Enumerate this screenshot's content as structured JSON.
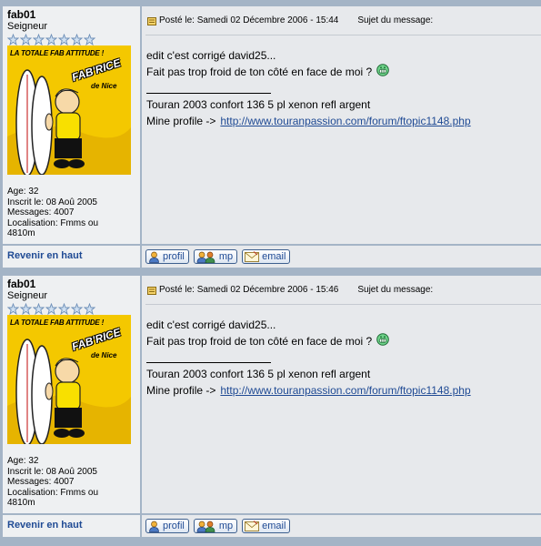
{
  "posts": [
    {
      "author": {
        "username": "fab01",
        "rank": "Seigneur",
        "star_count": 7,
        "avatar": {
          "slogan": "LA TOTALE FAB ATTITUDE !",
          "brand": "FAB'RICE",
          "city": "de Nice"
        },
        "age": "Age: 32",
        "joined": "Inscrit le: 08 Aoû 2005",
        "messages": "Messages: 4007",
        "location_line1": "Localisation: Fmms ou",
        "location_line2": "4810m"
      },
      "header": {
        "posted": "Posté le: Samedi 02 Décembre 2006 - 15:44",
        "subject": "Sujet du message:"
      },
      "body": {
        "line1": "edit c'est corrigé david25...",
        "line2": "Fait pas trop froid de ton côté en face de moi ?",
        "smiley": "grin-smiley-icon",
        "sig_line1": "Touran 2003 confort 136 5 pl xenon refl argent",
        "sig_prefix": "Mine profile ->",
        "sig_link": "http://www.touranpassion.com/forum/ftopic1148.php"
      },
      "footer": {
        "back_to_top": "Revenir en haut",
        "profile": "profil",
        "pm": "mp",
        "email": "email"
      }
    },
    {
      "author": {
        "username": "fab01",
        "rank": "Seigneur",
        "star_count": 7,
        "avatar": {
          "slogan": "LA TOTALE FAB ATTITUDE !",
          "brand": "FAB'RICE",
          "city": "de Nice"
        },
        "age": "Age: 32",
        "joined": "Inscrit le: 08 Aoû 2005",
        "messages": "Messages: 4007",
        "location_line1": "Localisation: Fmms ou",
        "location_line2": "4810m"
      },
      "header": {
        "posted": "Posté le: Samedi 02 Décembre 2006 - 15:46",
        "subject": "Sujet du message:"
      },
      "body": {
        "line1": "edit c'est corrigé david25...",
        "line2": "Fait pas trop froid de ton côté en face de moi ?",
        "smiley": "grin-smiley-icon",
        "sig_line1": "Touran 2003 confort 136 5 pl xenon refl argent",
        "sig_prefix": "Mine profile ->",
        "sig_link": "http://www.touranpassion.com/forum/ftopic1148.php"
      },
      "footer": {
        "back_to_top": "Revenir en haut",
        "profile": "profil",
        "pm": "mp",
        "email": "email"
      }
    }
  ],
  "colors": {
    "link": "#1f4a94",
    "row_light": "#eef0f2",
    "row_message": "#e7e9ec",
    "border": "#a4b4c6",
    "avatar_bg": "#f4c800"
  }
}
